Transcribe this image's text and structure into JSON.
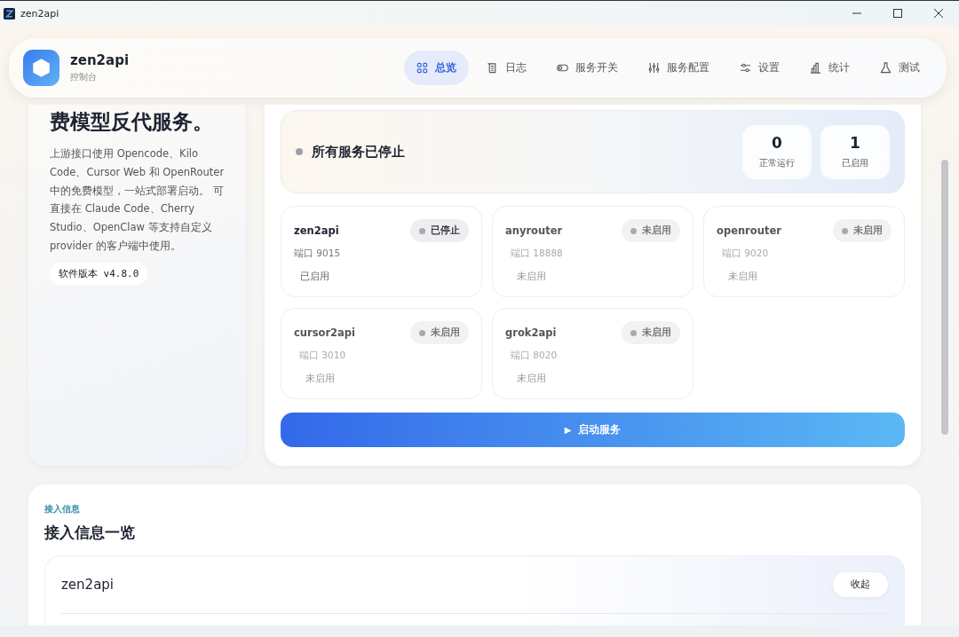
{
  "window": {
    "title": "zen2api"
  },
  "brand": {
    "name": "zen2api",
    "subtitle": "控制台"
  },
  "nav": [
    {
      "label": "总览",
      "selected": true
    },
    {
      "label": "日志",
      "selected": false
    },
    {
      "label": "服务开关",
      "selected": false
    },
    {
      "label": "服务配置",
      "selected": false
    },
    {
      "label": "设置",
      "selected": false
    },
    {
      "label": "统计",
      "selected": false
    },
    {
      "label": "测试",
      "selected": false
    }
  ],
  "intro": {
    "headline": "费模型反代服务。",
    "description": "上游接口使用 Opencode、Kilo Code、Cursor Web 和 OpenRouter 中的免费模型，一站式部署启动。 可直接在 Claude Code、Cherry Studio、OpenClaw 等支持自定义 provider 的客户端中使用。",
    "version": "软件版本 v4.8.0"
  },
  "overview": {
    "status": "所有服务已停止",
    "stats": [
      {
        "value": "0",
        "label": "正常运行"
      },
      {
        "value": "1",
        "label": "已启用"
      }
    ]
  },
  "services": [
    {
      "name": "zen2api",
      "badge": "已停止",
      "port": "端口 9015",
      "state": "已启用",
      "enabled": true
    },
    {
      "name": "anyrouter",
      "badge": "未启用",
      "port": "端口 18888",
      "state": "未启用",
      "enabled": false
    },
    {
      "name": "openrouter",
      "badge": "未启用",
      "port": "端口 9020",
      "state": "未启用",
      "enabled": false
    },
    {
      "name": "cursor2api",
      "badge": "未启用",
      "port": "端口 3010",
      "state": "未启用",
      "enabled": false
    },
    {
      "name": "grok2api",
      "badge": "未启用",
      "port": "端口 8020",
      "state": "未启用",
      "enabled": false
    }
  ],
  "start_button": {
    "icon": "▶",
    "label": "启动服务"
  },
  "access": {
    "eyebrow": "接入信息",
    "title": "接入信息一览",
    "entries": [
      {
        "name": "zen2api",
        "button": "收起"
      }
    ]
  }
}
